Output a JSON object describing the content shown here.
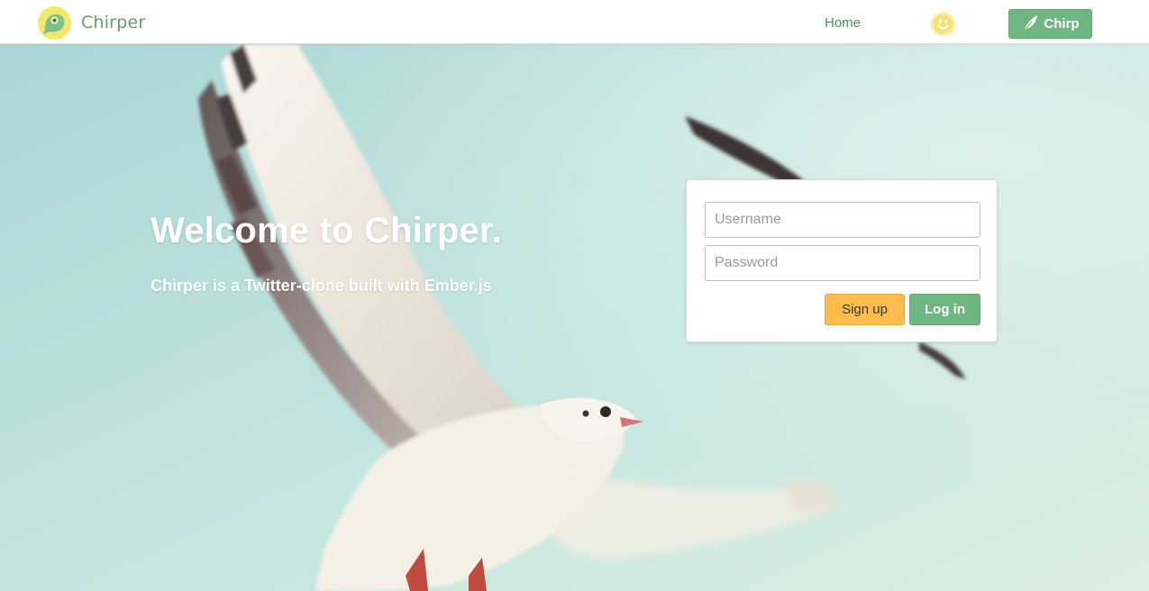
{
  "nav": {
    "brand": "Chirper",
    "home_label": "Home",
    "chirp_label": "Chirp"
  },
  "hero": {
    "title": "Welcome to Chirper.",
    "subtitle": "Chirper is a Twitter-clone built with Ember.js"
  },
  "login": {
    "username_placeholder": "Username",
    "password_placeholder": "Password",
    "signup_label": "Sign up",
    "login_label": "Log in"
  },
  "colors": {
    "brand_green": "#6fb782",
    "signup_yellow": "#fdbd4e",
    "sky": "#bfe3e3"
  }
}
